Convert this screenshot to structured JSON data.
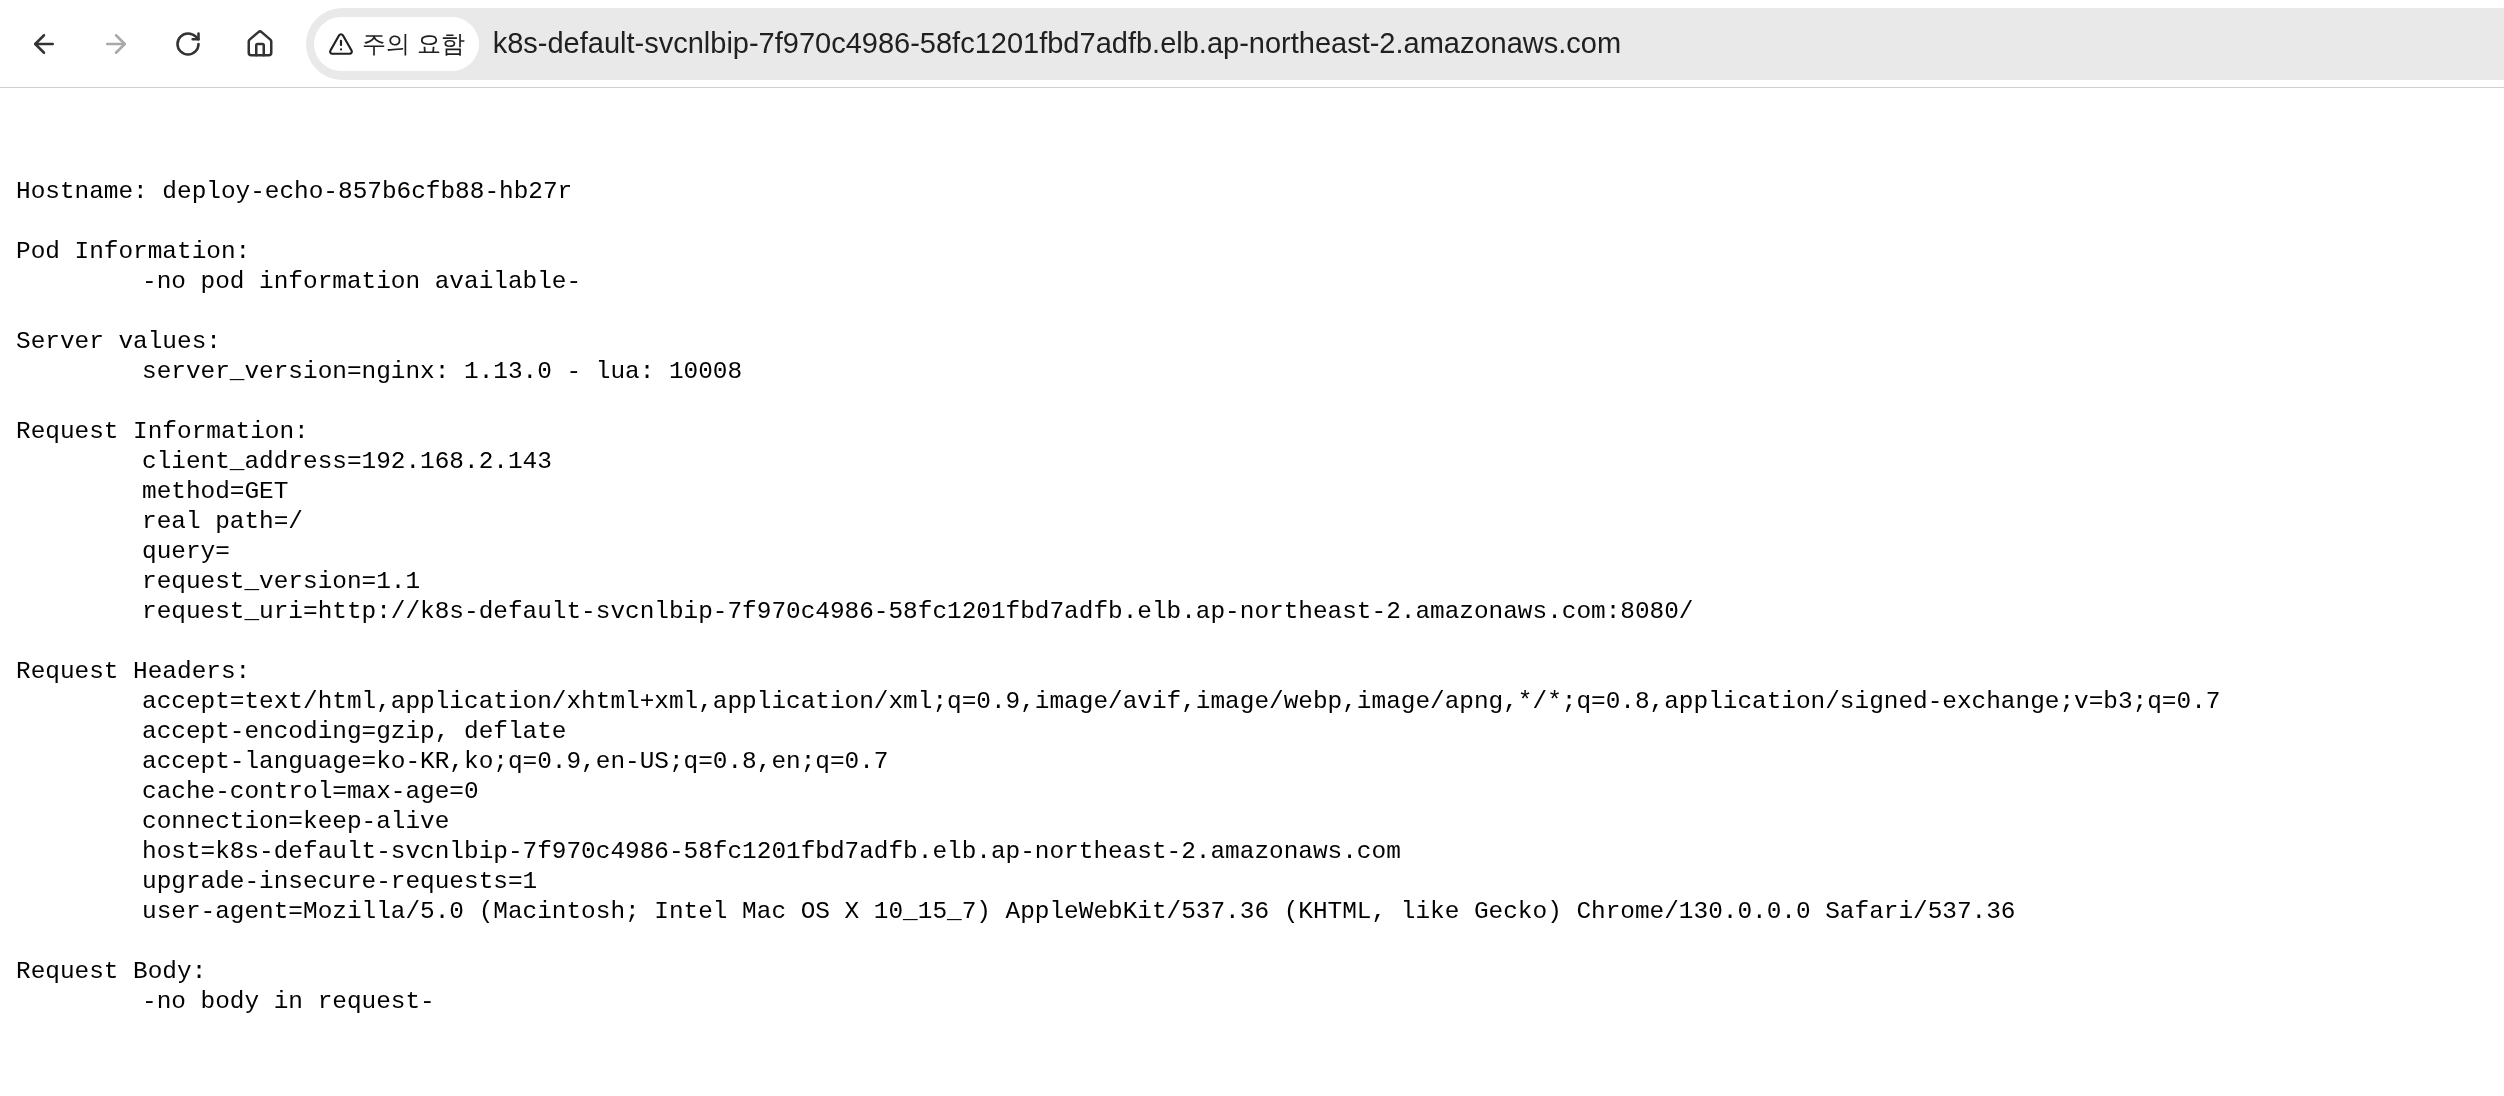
{
  "toolbar": {
    "back": {
      "disabled": false
    },
    "forward": {
      "disabled": true
    },
    "security_chip": "주의 요함",
    "url": "k8s-default-svcnlbip-7f970c4986-58fc1201fbd7adfb.elb.ap-northeast-2.amazonaws.com"
  },
  "page": {
    "hostname": "Hostname: deploy-echo-857b6cfb88-hb27r",
    "sections": [
      {
        "title": "Pod Information:",
        "lines": [
          "-no pod information available-"
        ]
      },
      {
        "title": "Server values:",
        "lines": [
          "server_version=nginx: 1.13.0 - lua: 10008"
        ]
      },
      {
        "title": "Request Information:",
        "lines": [
          "client_address=192.168.2.143",
          "method=GET",
          "real path=/",
          "query=",
          "request_version=1.1",
          "request_uri=http://k8s-default-svcnlbip-7f970c4986-58fc1201fbd7adfb.elb.ap-northeast-2.amazonaws.com:8080/"
        ]
      },
      {
        "title": "Request Headers:",
        "lines": [
          "accept=text/html,application/xhtml+xml,application/xml;q=0.9,image/avif,image/webp,image/apng,*/*;q=0.8,application/signed-exchange;v=b3;q=0.7",
          "accept-encoding=gzip, deflate",
          "accept-language=ko-KR,ko;q=0.9,en-US;q=0.8,en;q=0.7",
          "cache-control=max-age=0",
          "connection=keep-alive",
          "host=k8s-default-svcnlbip-7f970c4986-58fc1201fbd7adfb.elb.ap-northeast-2.amazonaws.com",
          "upgrade-insecure-requests=1",
          "user-agent=Mozilla/5.0 (Macintosh; Intel Mac OS X 10_15_7) AppleWebKit/537.36 (KHTML, like Gecko) Chrome/130.0.0.0 Safari/537.36"
        ]
      },
      {
        "title": "Request Body:",
        "lines": [
          "-no body in request-"
        ]
      }
    ]
  }
}
